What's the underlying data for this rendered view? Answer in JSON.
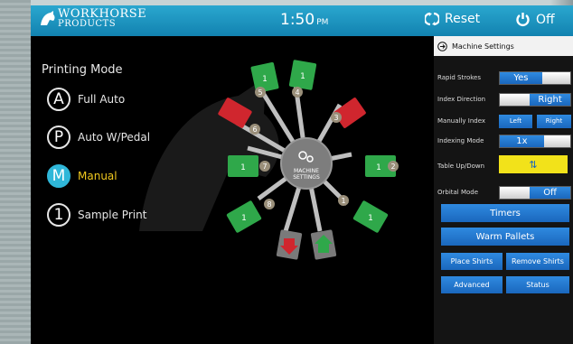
{
  "header": {
    "logo_line1": "WORKHORSE",
    "logo_line2": "PRODUCTS",
    "time": "1:50",
    "ampm": "PM",
    "reset_label": "Reset",
    "off_label": "Off"
  },
  "printing_mode": {
    "title": "Printing Mode",
    "items": [
      {
        "symbol": "A",
        "label": "Full Auto"
      },
      {
        "symbol": "P",
        "label": "Auto W/Pedal"
      },
      {
        "symbol": "M",
        "label": "Manual"
      },
      {
        "symbol": "1",
        "label": "Sample Print"
      }
    ]
  },
  "machine": {
    "center_line1": "MACHINE",
    "center_line2": "SETTINGS",
    "stations": [
      {
        "num": "1",
        "pallet": "1",
        "color": "green"
      },
      {
        "num": "2",
        "pallet": "1",
        "color": "green"
      },
      {
        "num": "3",
        "pallet": "",
        "color": "red"
      },
      {
        "num": "4",
        "pallet": "1",
        "color": "green"
      },
      {
        "num": "5",
        "pallet": "1",
        "color": "green"
      },
      {
        "num": "6",
        "pallet": "",
        "color": "red"
      },
      {
        "num": "7",
        "pallet": "1",
        "color": "green"
      },
      {
        "num": "8",
        "pallet": "1",
        "color": "green"
      }
    ]
  },
  "panel": {
    "title": "Machine Settings",
    "rapid_strokes_label": "Rapid Strokes",
    "rapid_strokes_value": "Yes",
    "index_direction_label": "Index Direction",
    "index_direction_value": "Right",
    "manually_index_label": "Manually Index",
    "left_label": "Left",
    "right_label": "Right",
    "indexing_mode_label": "Indexing Mode",
    "indexing_mode_value": "1x",
    "table_updown_label": "Table Up/Down",
    "orbital_mode_label": "Orbital Mode",
    "orbital_mode_value": "Off",
    "timers_label": "Timers",
    "warm_pallets_label": "Warm Pallets",
    "place_shirts_label": "Place Shirts",
    "remove_shirts_label": "Remove Shirts",
    "advanced_label": "Advanced",
    "status_label": "Status"
  },
  "colors": {
    "accent": "#2fb7d9",
    "button_blue": "#1f74cf",
    "pallet_green": "#2fa84a",
    "pallet_red": "#d0262e",
    "table_yellow": "#f2e21a"
  }
}
